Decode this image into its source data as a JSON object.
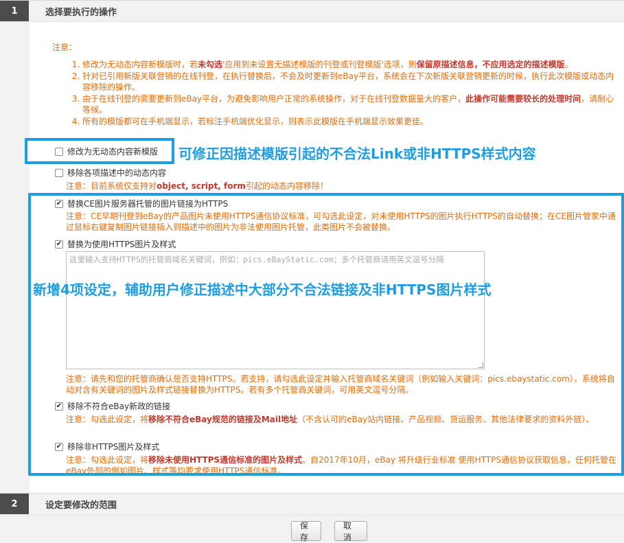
{
  "step1": {
    "number": "1",
    "title": "选择要执行的操作"
  },
  "notes": {
    "label": "注意：",
    "items": [
      {
        "parts": [
          {
            "t": "修改为无动态内容新模版时，若",
            "b": false
          },
          {
            "t": "未勾选",
            "b": true
          },
          {
            "t": "'应用到未设置无描述模版的刊登或刊登模版'选项，则",
            "b": false
          },
          {
            "t": "保留原描述信息，不应用选定的描述模版",
            "b": true
          },
          {
            "t": "。",
            "b": false
          }
        ]
      },
      {
        "parts": [
          {
            "t": "针对已引用新版关联营销的在线刊登，在执行替换后，不会及时更新到eBay平台，系统会在下次新版关联营销更新的时候，执行此次模版或动态内容移除的操作。",
            "b": false
          }
        ]
      },
      {
        "parts": [
          {
            "t": "由于在线刊登的需要更新到eBay平台，为避免影响用户正常的系统操作，对于在线刊登数据量大的客户，",
            "b": false
          },
          {
            "t": "此操作可能需要较长的处理时间",
            "b": true
          },
          {
            "t": "，请耐心等候。",
            "b": false
          }
        ]
      },
      {
        "parts": [
          {
            "t": "所有的模版都可在手机端显示，若标注手机端优化显示，则表示此模版在手机端显示效果更佳。",
            "b": false
          }
        ]
      }
    ]
  },
  "options": {
    "opt1": {
      "label": "修改为无动态内容新模版",
      "checked": false
    },
    "opt2": {
      "label": "移除各项描述中的动态内容",
      "checked": false,
      "hint_parts": [
        {
          "t": "注意：目前系统仅支持对",
          "b": false
        },
        {
          "t": "object, script, form",
          "b": true
        },
        {
          "t": "引起的动态内容移除！",
          "b": false
        }
      ]
    },
    "opt3": {
      "label": "替换CE图片服务器托管的图片链接为HTTPS",
      "checked": true,
      "hint_parts": [
        {
          "t": "注意：CE早期刊登到eBay的产品图片未使用HTTPS通信协议标准，可勾选此设定，对未使用HTTPS的图片执行HTTPS的自动替换；在CE图片管家中通过鼠标右键复制图片链接插入到描述中的图片为非法使用图片托管，此类图片不会被替换。",
          "b": false
        }
      ]
    },
    "opt4": {
      "label": "替换为使用HTTPS图片及样式",
      "checked": true,
      "placeholder": "这里输入支持HTTPS的托管商域名关键词，例如：pics.eBayStatic.com；多个托管商请用英文逗号分隔",
      "hint_parts": [
        {
          "t": "注意：请先和您的托管商确认是否支持HTTPS。若支持，请勾选此设定并输入托管商域名关键词（例如输入关键词：pics.ebaystatic.com），系统将自动对含有关键词的图片及样式链接替换为HTTPS。若有多个托管商关键词，可用英文逗号分隔。",
          "b": false
        }
      ]
    },
    "opt5": {
      "label": "移除不符合eBay新政的链接",
      "checked": true,
      "hint_parts": [
        {
          "t": "注意：勾选此设定，将",
          "b": false
        },
        {
          "t": "移除不符合eBay规范的链接及Mail地址",
          "b": true
        },
        {
          "t": "（不含认可的eBay站内链接、产品视频、货运服务、其他法律要求的资料外链）。",
          "b": false
        }
      ]
    },
    "opt6": {
      "label": "移除非HTTPS图片及样式",
      "checked": true,
      "hint_parts": [
        {
          "t": "注意：勾选此设定，将",
          "b": false
        },
        {
          "t": "移除未使用HTTPS通信标准的图片及样式",
          "b": true
        },
        {
          "t": "。自2017年10月，eBay 将升级行业标准 使用HTTPS通信协议获取信息，任何托管在eBay外部的例如图片、样式等均要求使用HTTPS通信标准。",
          "b": false
        }
      ]
    }
  },
  "annotations": {
    "a1": "可修正因描述模版引起的不合法Link或非HTTPS样式内容",
    "a2": "新增4项设定，辅助用户修正描述中大部分不合法链接及非HTTPS图片样式"
  },
  "step2": {
    "number": "2",
    "title": "设定要修改的范围"
  },
  "footer": {
    "save": "保存",
    "cancel": "取消"
  },
  "colors": {
    "note": "#e46c0a",
    "emphasis": "#c0392b",
    "annotation": "#1e9ee0"
  }
}
